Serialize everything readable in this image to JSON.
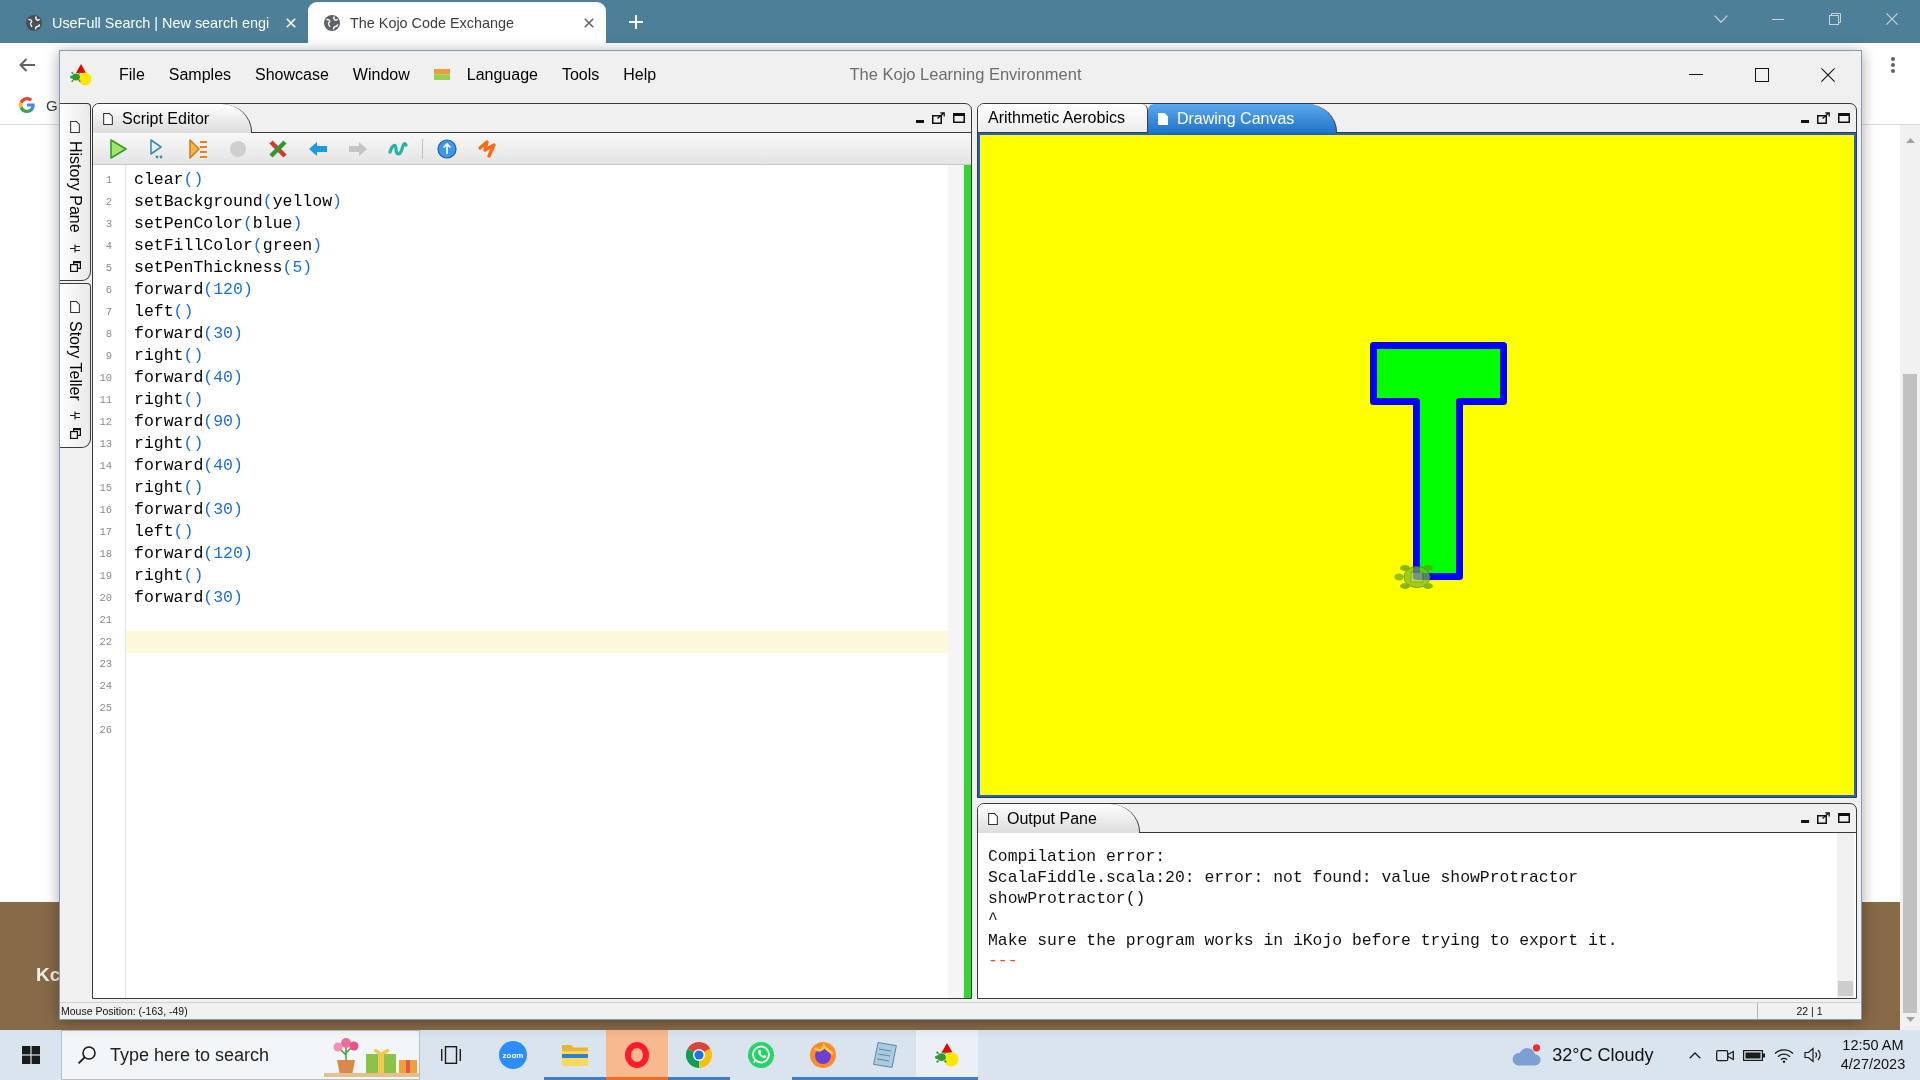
{
  "browser": {
    "tabs": [
      {
        "title": "UseFull Search | New search engi",
        "selected": false
      },
      {
        "title": "The Kojo Code Exchange",
        "selected": true
      }
    ],
    "bookmarks": [
      {
        "label": "G"
      }
    ],
    "page": {
      "banner_text": "Kc"
    }
  },
  "kojo": {
    "title": "The Kojo Learning Environment",
    "menu": [
      {
        "label": "File",
        "kind": "plain"
      },
      {
        "label": "Samples",
        "kind": "plain"
      },
      {
        "label": "Showcase",
        "kind": "plain"
      },
      {
        "label": "Window",
        "kind": "plain"
      },
      {
        "label": "Language",
        "kind": "flag"
      },
      {
        "label": "Tools",
        "kind": "plain"
      },
      {
        "label": "Help",
        "kind": "plain"
      }
    ],
    "side_tabs": [
      {
        "label": "History Pane"
      },
      {
        "label": "Story Teller"
      }
    ],
    "editor": {
      "tab": "Script Editor",
      "toolbar": [
        {
          "kind": "run",
          "disabled": false
        },
        {
          "kind": "run-worksheet",
          "disabled": false
        },
        {
          "kind": "trace",
          "disabled": false
        },
        {
          "kind": "stop",
          "disabled": true
        },
        {
          "kind": "clear",
          "disabled": false
        },
        {
          "kind": "back",
          "disabled": false
        },
        {
          "kind": "forward",
          "disabled": true
        },
        {
          "kind": "format",
          "disabled": false
        },
        {
          "kind": "separator"
        },
        {
          "kind": "upload",
          "disabled": false
        },
        {
          "kind": "clear-output",
          "disabled": false
        }
      ],
      "lines": [
        {
          "number": "1",
          "code": "clear()",
          "current": false
        },
        {
          "number": "2",
          "code": "setBackground(yellow)",
          "current": false
        },
        {
          "number": "3",
          "code": "setPenColor(blue)",
          "current": false
        },
        {
          "number": "4",
          "code": "setFillColor(green)",
          "current": false
        },
        {
          "number": "5",
          "code": "setPenThickness(5)",
          "current": false
        },
        {
          "number": "6",
          "code": "forward(120)",
          "current": false
        },
        {
          "number": "7",
          "code": "left()",
          "current": false
        },
        {
          "number": "8",
          "code": "forward(30)",
          "current": false
        },
        {
          "number": "9",
          "code": "right()",
          "current": false
        },
        {
          "number": "10",
          "code": "forward(40)",
          "current": false
        },
        {
          "number": "11",
          "code": "right()",
          "current": false
        },
        {
          "number": "12",
          "code": "forward(90)",
          "current": false
        },
        {
          "number": "13",
          "code": "right()",
          "current": false
        },
        {
          "number": "14",
          "code": "forward(40)",
          "current": false
        },
        {
          "number": "15",
          "code": "right()",
          "current": false
        },
        {
          "number": "16",
          "code": "forward(30)",
          "current": false
        },
        {
          "number": "17",
          "code": "left()",
          "current": false
        },
        {
          "number": "18",
          "code": "forward(120)",
          "current": false
        },
        {
          "number": "19",
          "code": "right()",
          "current": false
        },
        {
          "number": "20",
          "code": "forward(30)",
          "current": false
        },
        {
          "number": "21",
          "current": false
        },
        {
          "number": "22",
          "current": true
        },
        {
          "number": "23",
          "current": false
        },
        {
          "number": "24",
          "current": false
        },
        {
          "number": "25",
          "current": false
        },
        {
          "number": "26",
          "current": false
        }
      ]
    },
    "canvas_tabs": [
      {
        "label": "Arithmetic Aerobics",
        "selected": false
      },
      {
        "label": "Drawing Canvas",
        "selected": true
      }
    ],
    "output": {
      "tab": "Output Pane",
      "lines": [
        {
          "text": "Compilation error:",
          "kind": "plain"
        },
        {
          "text": "ScalaFiddle.scala:20: error: not found: value showProtractor",
          "kind": "plain"
        },
        {
          "text": "showProtractor()",
          "kind": "plain"
        },
        {
          "text": "^",
          "kind": "plain"
        },
        {
          "text": "Make sure the program works in iKojo before trying to export it.",
          "kind": "plain"
        },
        {
          "text": "---",
          "kind": "separator"
        }
      ]
    },
    "status_bar": {
      "mouse_position": "Mouse Position: (-163, -49)",
      "caret": "22 | 1"
    }
  },
  "taskbar": {
    "search": {
      "placeholder": "Type here to search"
    },
    "apps": [
      {
        "kind": "zoom",
        "label": "zoom",
        "running": false,
        "attention": false,
        "active": false
      },
      {
        "kind": "file-explorer",
        "running": true,
        "attention": false,
        "active": false
      },
      {
        "kind": "opera",
        "running": true,
        "attention": true,
        "active": false
      },
      {
        "kind": "chrome",
        "running": true,
        "attention": false,
        "active": false
      },
      {
        "kind": "whatsapp",
        "running": false,
        "attention": false,
        "active": false
      },
      {
        "kind": "firefox",
        "running": true,
        "attention": false,
        "active": false
      },
      {
        "kind": "notepad",
        "running": true,
        "attention": false,
        "active": false
      },
      {
        "kind": "kojo",
        "running": true,
        "attention": false,
        "active": true
      }
    ],
    "weather": "32°C Cloudy",
    "time": "12:50 AM",
    "date": "4/27/2023"
  }
}
